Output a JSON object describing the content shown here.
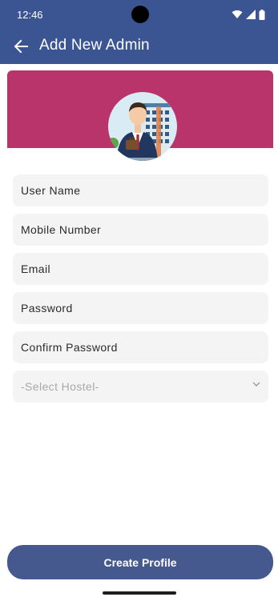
{
  "status_bar": {
    "time": "12:46",
    "icons": [
      "wifi-icon",
      "signal-icon",
      "battery-icon"
    ]
  },
  "app_bar": {
    "title": "Add New Admin",
    "back_icon": "arrow-back-icon"
  },
  "banner": {
    "color": "#b8346b",
    "illustration": "admin-building-avatar"
  },
  "form": {
    "fields": [
      {
        "label": "User Name"
      },
      {
        "label": "Mobile Number"
      },
      {
        "label": "Email"
      },
      {
        "label": "Password"
      },
      {
        "label": "Confirm Password"
      }
    ],
    "hostel_select": {
      "placeholder": "-Select Hostel-",
      "icon": "chevron-down-icon"
    }
  },
  "actions": {
    "create_profile_label": "Create Profile"
  },
  "colors": {
    "primary": "#3a5592",
    "accent": "#b8346b",
    "button": "#46598f",
    "field_bg": "#f4f4f4"
  }
}
